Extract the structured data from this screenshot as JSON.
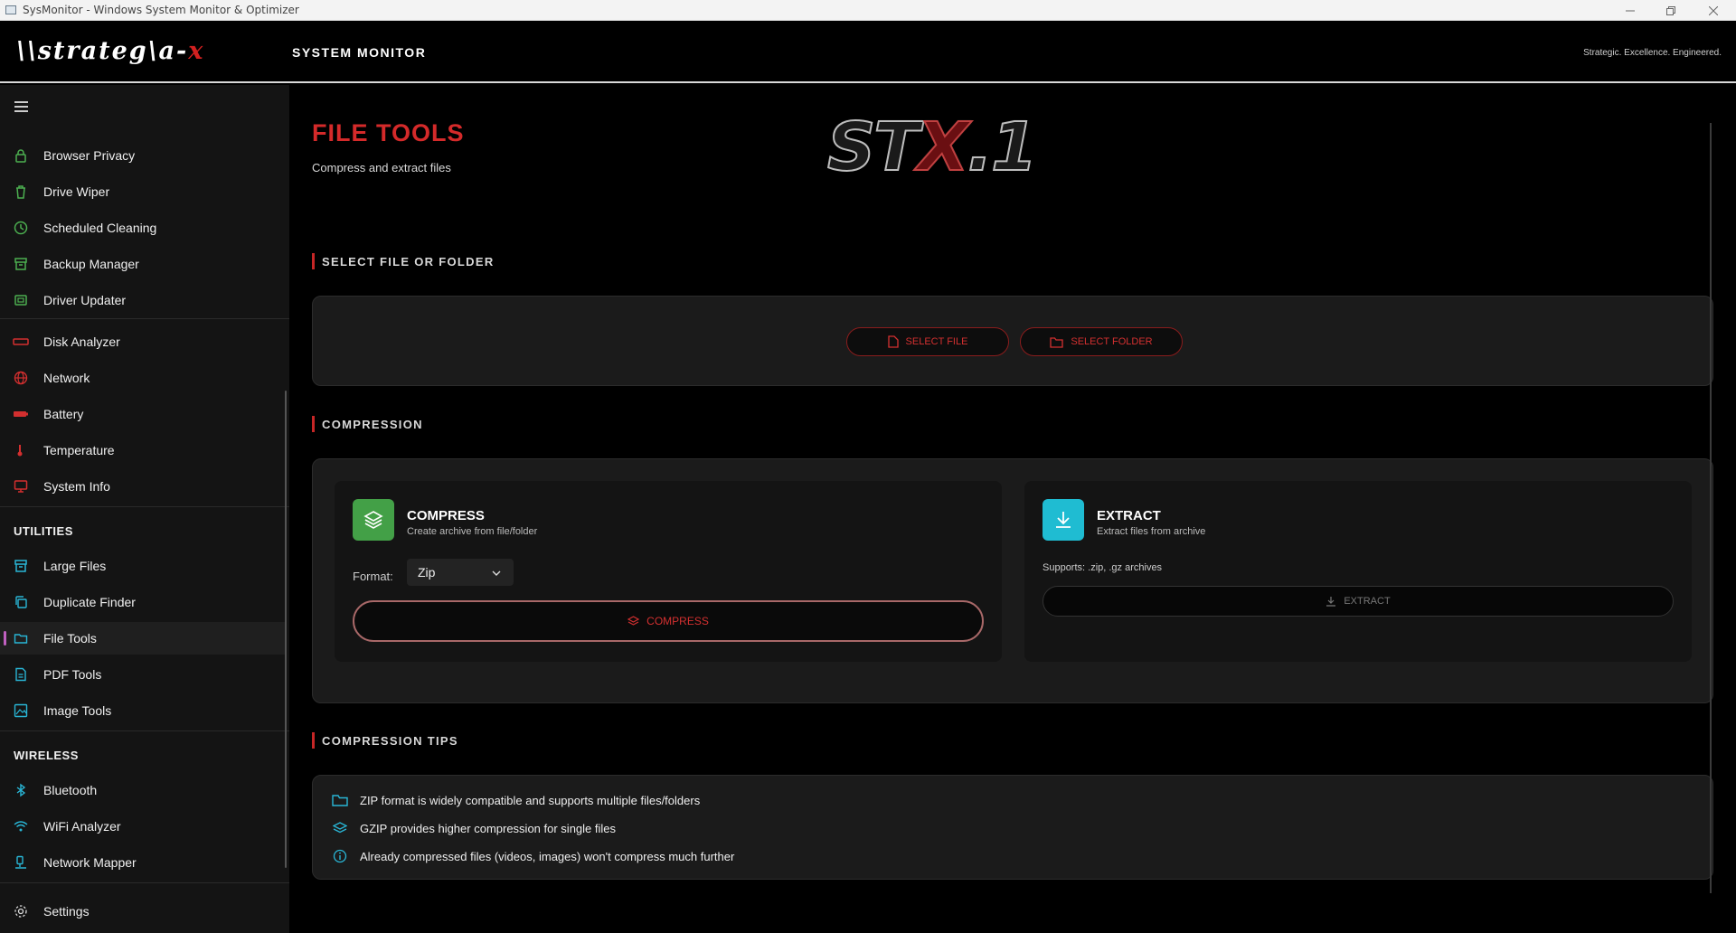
{
  "window": {
    "title": "SysMonitor - Windows System Monitor & Optimizer"
  },
  "header": {
    "logo_text": "\\\\strateg\\a-",
    "logo_accent": "x",
    "app_title": "SYSTEM MONITOR",
    "tagline": "Strategic. Excellence. Engineered."
  },
  "sidebar": {
    "group1": [
      {
        "label": "Browser Privacy",
        "icon": "lock-icon"
      },
      {
        "label": "Drive Wiper",
        "icon": "trash-icon"
      },
      {
        "label": "Scheduled Cleaning",
        "icon": "clock-icon"
      },
      {
        "label": "Backup Manager",
        "icon": "archive-icon"
      },
      {
        "label": "Driver Updater",
        "icon": "chip-icon"
      }
    ],
    "group2": [
      {
        "label": "Disk Analyzer",
        "icon": "disk-icon"
      },
      {
        "label": "Network",
        "icon": "globe-icon"
      },
      {
        "label": "Battery",
        "icon": "battery-icon"
      },
      {
        "label": "Temperature",
        "icon": "thermometer-icon"
      },
      {
        "label": "System Info",
        "icon": "monitor-icon"
      }
    ],
    "utilities_label": "UTILITIES",
    "utilities": [
      {
        "label": "Large Files",
        "icon": "archive-icon"
      },
      {
        "label": "Duplicate Finder",
        "icon": "copy-icon"
      },
      {
        "label": "File Tools",
        "icon": "folder-icon"
      },
      {
        "label": "PDF Tools",
        "icon": "document-icon"
      },
      {
        "label": "Image Tools",
        "icon": "image-icon"
      }
    ],
    "wireless_label": "WIRELESS",
    "wireless": [
      {
        "label": "Bluetooth",
        "icon": "bluetooth-icon"
      },
      {
        "label": "WiFi Analyzer",
        "icon": "wifi-icon"
      },
      {
        "label": "Network Mapper",
        "icon": "network-mapper-icon"
      }
    ],
    "settings": {
      "label": "Settings",
      "icon": "gear-icon"
    },
    "active_item": "File Tools"
  },
  "page": {
    "title": "FILE TOOLS",
    "subtitle": "Compress and extract files",
    "brand": "STX",
    "brand_accent": "X",
    "brand_suffix": ".1"
  },
  "select_section": {
    "heading": "SELECT FILE OR FOLDER",
    "select_file_label": "SELECT FILE",
    "select_folder_label": "SELECT FOLDER"
  },
  "compression_section": {
    "heading": "COMPRESSION",
    "compress": {
      "title": "COMPRESS",
      "subtitle": "Create archive from file/folder",
      "format_label": "Format:",
      "format_value": "Zip",
      "button_label": "COMPRESS"
    },
    "extract": {
      "title": "EXTRACT",
      "subtitle": "Extract files from archive",
      "supports": "Supports: .zip, .gz archives",
      "button_label": "EXTRACT"
    }
  },
  "tips_section": {
    "heading": "COMPRESSION TIPS",
    "tips": [
      {
        "text": "ZIP format is widely compatible and supports multiple files/folders",
        "icon": "folder-icon"
      },
      {
        "text": "GZIP provides higher compression for single files",
        "icon": "layers-icon"
      },
      {
        "text": "Already compressed files (videos, images) won't compress much further",
        "icon": "info-icon"
      }
    ]
  },
  "colors": {
    "accent_red": "#d42a2a",
    "green_icon": "#4caf50",
    "red_icon": "#d32f2f",
    "cyan_icon": "#29b6d6",
    "compress_badge": "#43a047",
    "extract_badge": "#1fbcd2"
  }
}
